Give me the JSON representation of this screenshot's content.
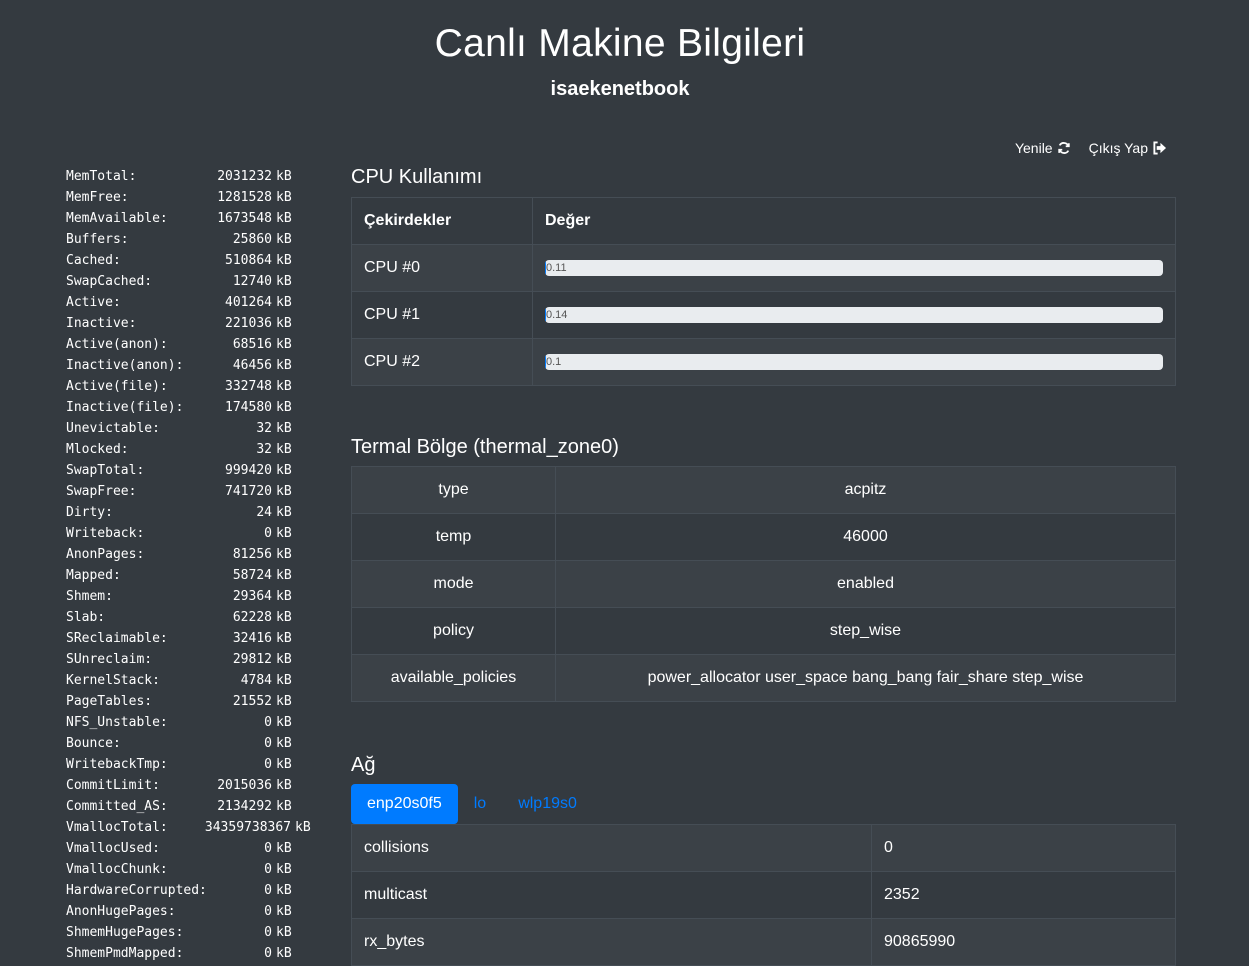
{
  "header": {
    "title": "Canlı Makine Bilgileri",
    "hostname": "isaekenetbook"
  },
  "actions": {
    "refresh_label": "Yenile",
    "logout_label": "Çıkış Yap"
  },
  "meminfo": [
    {
      "key": "MemTotal:",
      "value": "2031232",
      "unit": "kB"
    },
    {
      "key": "MemFree:",
      "value": "1281528",
      "unit": "kB"
    },
    {
      "key": "MemAvailable:",
      "value": "1673548",
      "unit": "kB"
    },
    {
      "key": "Buffers:",
      "value": "25860",
      "unit": "kB"
    },
    {
      "key": "Cached:",
      "value": "510864",
      "unit": "kB"
    },
    {
      "key": "SwapCached:",
      "value": "12740",
      "unit": "kB"
    },
    {
      "key": "Active:",
      "value": "401264",
      "unit": "kB"
    },
    {
      "key": "Inactive:",
      "value": "221036",
      "unit": "kB"
    },
    {
      "key": "Active(anon):",
      "value": "68516",
      "unit": "kB"
    },
    {
      "key": "Inactive(anon):",
      "value": "46456",
      "unit": "kB"
    },
    {
      "key": "Active(file):",
      "value": "332748",
      "unit": "kB"
    },
    {
      "key": "Inactive(file):",
      "value": "174580",
      "unit": "kB"
    },
    {
      "key": "Unevictable:",
      "value": "32",
      "unit": "kB"
    },
    {
      "key": "Mlocked:",
      "value": "32",
      "unit": "kB"
    },
    {
      "key": "SwapTotal:",
      "value": "999420",
      "unit": "kB"
    },
    {
      "key": "SwapFree:",
      "value": "741720",
      "unit": "kB"
    },
    {
      "key": "Dirty:",
      "value": "24",
      "unit": "kB"
    },
    {
      "key": "Writeback:",
      "value": "0",
      "unit": "kB"
    },
    {
      "key": "AnonPages:",
      "value": "81256",
      "unit": "kB"
    },
    {
      "key": "Mapped:",
      "value": "58724",
      "unit": "kB"
    },
    {
      "key": "Shmem:",
      "value": "29364",
      "unit": "kB"
    },
    {
      "key": "Slab:",
      "value": "62228",
      "unit": "kB"
    },
    {
      "key": "SReclaimable:",
      "value": "32416",
      "unit": "kB"
    },
    {
      "key": "SUnreclaim:",
      "value": "29812",
      "unit": "kB"
    },
    {
      "key": "KernelStack:",
      "value": "4784",
      "unit": "kB"
    },
    {
      "key": "PageTables:",
      "value": "21552",
      "unit": "kB"
    },
    {
      "key": "NFS_Unstable:",
      "value": "0",
      "unit": "kB"
    },
    {
      "key": "Bounce:",
      "value": "0",
      "unit": "kB"
    },
    {
      "key": "WritebackTmp:",
      "value": "0",
      "unit": "kB"
    },
    {
      "key": "CommitLimit:",
      "value": "2015036",
      "unit": "kB"
    },
    {
      "key": "Committed_AS:",
      "value": "2134292",
      "unit": "kB"
    },
    {
      "key": "VmallocTotal:",
      "value": "34359738367",
      "unit": "kB"
    },
    {
      "key": "VmallocUsed:",
      "value": "0",
      "unit": "kB"
    },
    {
      "key": "VmallocChunk:",
      "value": "0",
      "unit": "kB"
    },
    {
      "key": "HardwareCorrupted:",
      "value": "0",
      "unit": "kB"
    },
    {
      "key": "AnonHugePages:",
      "value": "0",
      "unit": "kB"
    },
    {
      "key": "ShmemHugePages:",
      "value": "0",
      "unit": "kB"
    },
    {
      "key": "ShmemPmdMapped:",
      "value": "0",
      "unit": "kB"
    }
  ],
  "cpu": {
    "title": "CPU Kullanımı",
    "col_cores": "Çekirdekler",
    "col_value": "Değer",
    "rows": [
      {
        "label": "CPU #0",
        "value": "0.11",
        "fraction": 0.0011
      },
      {
        "label": "CPU #1",
        "value": "0.14",
        "fraction": 0.0014
      },
      {
        "label": "CPU #2",
        "value": "0.1",
        "fraction": 0.001
      }
    ]
  },
  "thermal": {
    "title": "Termal Bölge (thermal_zone0)",
    "rows": [
      {
        "key": "type",
        "value": "acpitz"
      },
      {
        "key": "temp",
        "value": "46000"
      },
      {
        "key": "mode",
        "value": "enabled"
      },
      {
        "key": "policy",
        "value": "step_wise"
      },
      {
        "key": "available_policies",
        "value": "power_allocator user_space bang_bang fair_share step_wise"
      }
    ]
  },
  "network": {
    "title": "Ağ",
    "tabs": [
      "enp20s0f5",
      "lo",
      "wlp19s0"
    ],
    "active_tab": 0,
    "rows": [
      {
        "key": "collisions",
        "value": "0"
      },
      {
        "key": "multicast",
        "value": "2352"
      },
      {
        "key": "rx_bytes",
        "value": "90865990"
      }
    ]
  },
  "icons": {
    "refresh": "refresh-icon",
    "logout": "sign-out-icon"
  },
  "colors": {
    "background": "#343a40",
    "accent": "#007bff",
    "progress_track": "#e9ecef"
  }
}
